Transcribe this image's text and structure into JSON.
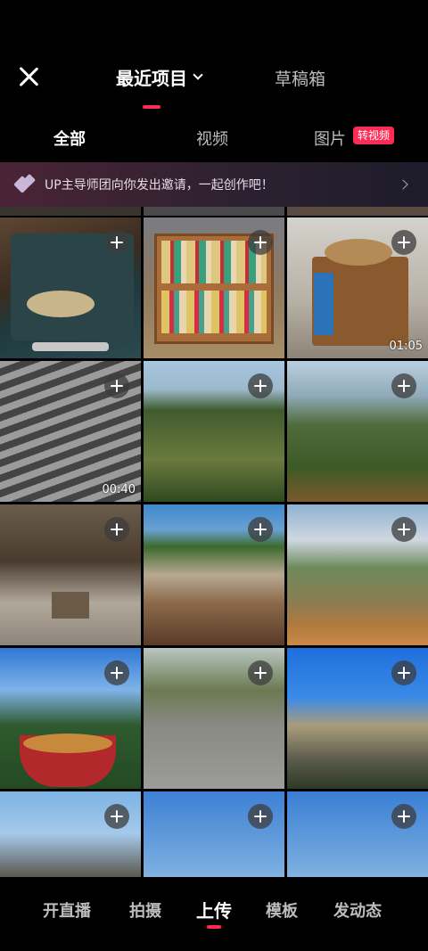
{
  "header": {
    "close_icon": "close-icon",
    "tabs": [
      {
        "label": "最近项目",
        "active": true,
        "has_dropdown": true
      },
      {
        "label": "草稿箱",
        "active": false
      }
    ]
  },
  "filters": {
    "items": [
      {
        "label": "全部",
        "active": true
      },
      {
        "label": "视频",
        "active": false
      },
      {
        "label": "图片",
        "active": false
      }
    ],
    "badge": "转视频"
  },
  "banner": {
    "text": "UP主导师团向你发出邀请，一起创作吧！",
    "icon": "star-sparkle-icon"
  },
  "grid": {
    "items": [
      {
        "subject": "record player",
        "duration": ""
      },
      {
        "subject": "display case",
        "duration": ""
      },
      {
        "subject": "wooden cart",
        "duration": "01:05"
      },
      {
        "subject": "striped shadow floor",
        "duration": "00:40"
      },
      {
        "subject": "mountain valley",
        "duration": ""
      },
      {
        "subject": "mountain ridge",
        "duration": ""
      },
      {
        "subject": "ancestral hall",
        "duration": ""
      },
      {
        "subject": "hillside village",
        "duration": ""
      },
      {
        "subject": "cable car view",
        "duration": ""
      },
      {
        "subject": "noodle cup peak",
        "duration": ""
      },
      {
        "subject": "stone path",
        "duration": ""
      },
      {
        "subject": "granite peaks",
        "duration": ""
      },
      {
        "subject": "rock pillar",
        "duration": ""
      },
      {
        "subject": "blue sky horizon",
        "duration": ""
      },
      {
        "subject": "blue sky horizon 2",
        "duration": ""
      }
    ]
  },
  "bottom_nav": {
    "items": [
      {
        "label": "开直播",
        "active": false
      },
      {
        "label": "拍摄",
        "active": false
      },
      {
        "label": "上传",
        "active": true
      },
      {
        "label": "模板",
        "active": false
      },
      {
        "label": "发动态",
        "active": false
      }
    ]
  },
  "colors": {
    "accent": "#fe2c55",
    "background": "#000000"
  }
}
